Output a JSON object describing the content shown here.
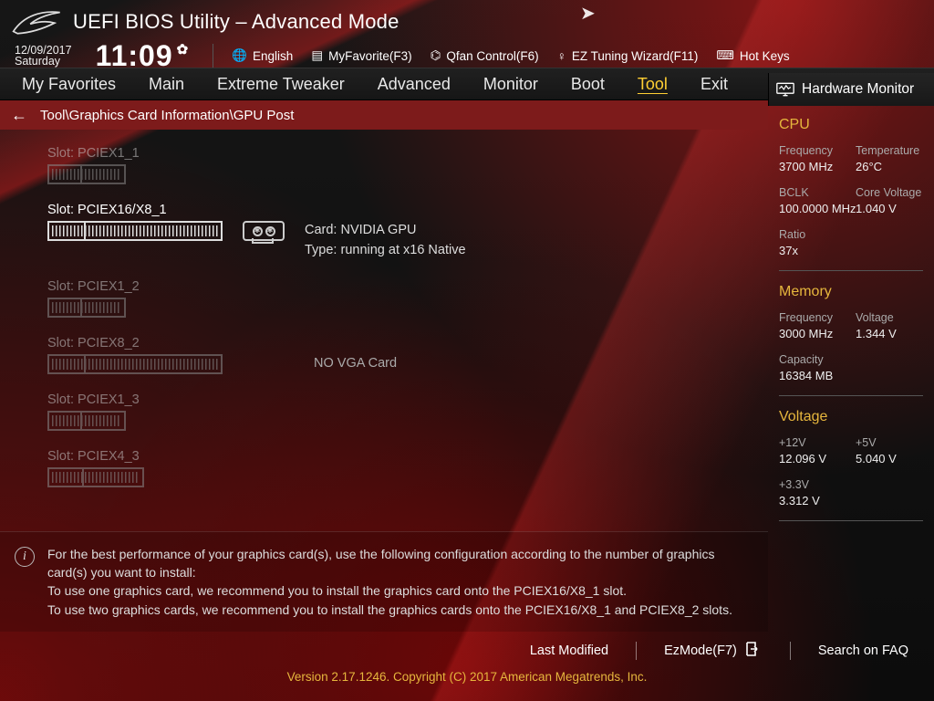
{
  "header": {
    "title": "UEFI BIOS Utility – Advanced Mode",
    "date": "12/09/2017",
    "day": "Saturday",
    "time": "11:09",
    "quicklinks": {
      "language": "English",
      "favorite": "MyFavorite(F3)",
      "qfan": "Qfan Control(F6)",
      "eztune": "EZ Tuning Wizard(F11)",
      "hotkeys": "Hot Keys"
    }
  },
  "tabs": [
    "My Favorites",
    "Main",
    "Extreme Tweaker",
    "Advanced",
    "Monitor",
    "Boot",
    "Tool",
    "Exit"
  ],
  "tabs_active_index": 6,
  "breadcrumb": "Tool\\Graphics Card Information\\GPU Post",
  "slots": [
    {
      "label": "Slot: PCIEX1_1",
      "size": "x1",
      "active": false,
      "card": null,
      "type": null
    },
    {
      "label": "Slot: PCIEX16/X8_1",
      "size": "x16",
      "active": true,
      "card": "Card: NVIDIA GPU",
      "type": "Type: running at x16 Native"
    },
    {
      "label": "Slot: PCIEX1_2",
      "size": "x1",
      "active": false,
      "card": null,
      "type": null
    },
    {
      "label": "Slot: PCIEX8_2",
      "size": "x16",
      "active": false,
      "card": "NO VGA Card",
      "type": null,
      "novga": true
    },
    {
      "label": "Slot: PCIEX1_3",
      "size": "x1",
      "active": false,
      "card": null,
      "type": null
    },
    {
      "label": "Slot: PCIEX4_3",
      "size": "x4",
      "active": false,
      "card": null,
      "type": null
    }
  ],
  "help": {
    "l1": "For the best performance of your graphics card(s), use the following configuration according to the number of graphics card(s) you want to install:",
    "l2": "To use one graphics card, we recommend you to install  the graphics card onto the PCIEX16/X8_1 slot.",
    "l3": "To use two graphics cards, we recommend you to install the graphics cards onto the PCIEX16/X8_1 and PCIEX8_2 slots."
  },
  "hw_header": "Hardware Monitor",
  "hw": {
    "cpu_title": "CPU",
    "cpu": [
      [
        {
          "lab": "Frequency",
          "val": "3700 MHz"
        },
        {
          "lab": "Temperature",
          "val": "26°C"
        }
      ],
      [
        {
          "lab": "BCLK",
          "val": "100.0000 MHz"
        },
        {
          "lab": "Core Voltage",
          "val": "1.040 V"
        }
      ],
      [
        {
          "lab": "Ratio",
          "val": "37x"
        }
      ]
    ],
    "mem_title": "Memory",
    "mem": [
      [
        {
          "lab": "Frequency",
          "val": "3000 MHz"
        },
        {
          "lab": "Voltage",
          "val": "1.344 V"
        }
      ],
      [
        {
          "lab": "Capacity",
          "val": "16384 MB"
        }
      ]
    ],
    "volt_title": "Voltage",
    "volt": [
      [
        {
          "lab": "+12V",
          "val": "12.096 V"
        },
        {
          "lab": "+5V",
          "val": "5.040 V"
        }
      ],
      [
        {
          "lab": "+3.3V",
          "val": "3.312 V"
        }
      ]
    ]
  },
  "footer": {
    "last_modified": "Last Modified",
    "ezmode": "EzMode(F7)",
    "faq": "Search on FAQ",
    "copyright": "Version 2.17.1246. Copyright (C) 2017 American Megatrends, Inc."
  }
}
